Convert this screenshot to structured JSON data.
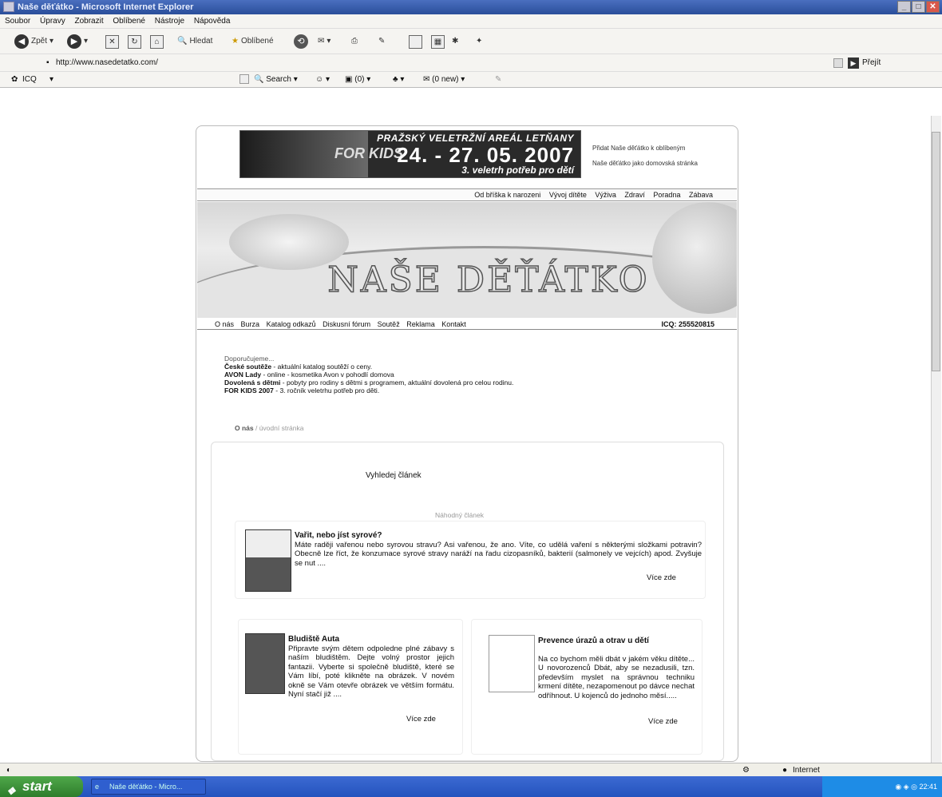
{
  "window": {
    "title": "Naše děťátko - Microsoft Internet Explorer"
  },
  "menu": [
    "Soubor",
    "Úpravy",
    "Zobrazit",
    "Oblíbené",
    "Nástroje",
    "Nápověda"
  ],
  "toolbar": {
    "back": "Zpět",
    "search": "Hledat",
    "favorites": "Oblíbené"
  },
  "address": {
    "url": "http://www.nasedetatko.com/",
    "go": "Přejít"
  },
  "icqbar": {
    "icq": "ICQ",
    "search": "Search",
    "counter": "(0)",
    "mail": "(0 new)"
  },
  "banner": {
    "headline": "PRAŽSKÝ VELETRŽNÍ AREÁL LETŇANY",
    "dates": "24. - 27. 05. 2007",
    "sub": "3. veletrh potřeb pro dětí",
    "logo": "FOR KIDS"
  },
  "sidelinks": {
    "fav": "Přidat Naše děťátko k oblíbeným",
    "home": "Naše děťátko jako domovská stránka"
  },
  "topnav": [
    "Od bříška k narozeni",
    "Vývoj dítěte",
    "Výživa",
    "Zdraví",
    "Poradna",
    "Zábava"
  ],
  "hero": {
    "title": "NAŠE DĚŤÁTKO"
  },
  "mainnav": {
    "links": [
      "O nás",
      "Burza",
      "Katalog odkazů",
      "Diskusní fórum",
      "Soutěž",
      "Reklama",
      "Kontakt"
    ],
    "icq": "ICQ: 255520815"
  },
  "recommend": {
    "heading": "Doporučujeme...",
    "items": [
      {
        "b": "České soutěže",
        "t": " - aktuální katalog soutěží o ceny."
      },
      {
        "b": "AVON Lady",
        "t": " - online - kosmetika Avon v pohodlí domova"
      },
      {
        "b": "Dovolená s dětmi",
        "t": " - pobyty pro rodiny s dětmi s programem, aktuální dovolená pro celou rodinu."
      },
      {
        "b": "FOR KIDS 2007",
        "t": " - 3. ročník veletrhu potřeb pro děti."
      }
    ]
  },
  "crumb": {
    "a": "O nás",
    "b": " / úvodní stránka"
  },
  "find": "Vyhledej článek",
  "random": "Náhodný článek",
  "articles": {
    "a1": {
      "title": "Vařit, nebo jíst syrové?",
      "text": "Máte raději vařenou nebo syrovou stravu? Asi vařenou, že ano. Víte, co udělá vaření s některými složkami potravin? Obecně lze říct, že konzumace syrové stravy naráží na řadu cizopasníků, bakterií (salmonely ve vejcích) apod. Zvyšuje se nut ....",
      "more": "Více zde"
    },
    "a2": {
      "title": "Bludiště Auta",
      "text": "Připravte svým dětem odpoledne plné zábavy s naším bludištěm. Dejte volný prostor jejich fantazii. Vyberte si společně bludiště, které se Vám líbí, poté klikněte na obrázek. V novém okně se Vám otevře obrázek ve větším formátu. Nyní stačí již ....",
      "more": "Více zde"
    },
    "a3": {
      "title": "Prevence úrazů a otrav u dětí",
      "text": "Na co bychom měli dbát v jakém věku dítěte... U novorozenců Dbát, aby se nezadusili, tzn. především myslet na správnou techniku krmení dítěte, nezapomenout po dávce nechat odříhnout. U kojenců do jednoho měsí.....",
      "more": "Více zde"
    }
  },
  "status": {
    "zone": "Internet"
  },
  "taskbar": {
    "start": "start",
    "item": "Naše děťátko - Micro...",
    "clock": "22:41"
  }
}
